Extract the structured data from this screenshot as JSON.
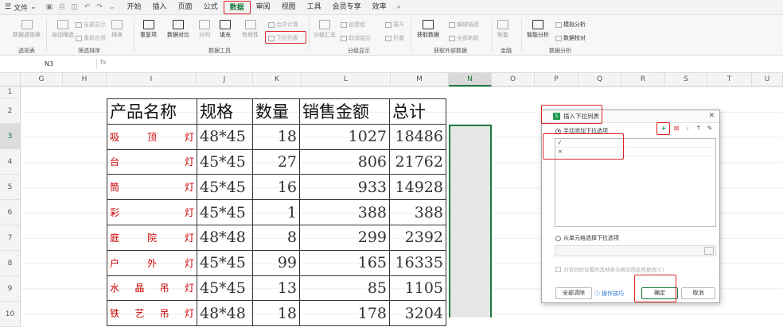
{
  "menubar": {
    "file": "文件",
    "tabs": [
      "开始",
      "插入",
      "页面",
      "公式",
      "数据",
      "审阅",
      "视图",
      "工具",
      "会员专享",
      "效率"
    ],
    "active_tab": "数据"
  },
  "ribbon": {
    "buttons": [
      "数据透视表",
      "自动筛选",
      "全部显示",
      "重新应用",
      "排序",
      "重复项",
      "数据对比",
      "分列",
      "填充",
      "有效性",
      "合并计算",
      "下拉列表",
      "分级汇总",
      "创建组",
      "取消组合",
      "展开",
      "折叠",
      "获取数据",
      "编辑链接",
      "全部刷新",
      "账套",
      "智能分析",
      "模拟分析",
      "数据校对"
    ],
    "groups": [
      "透视表",
      "筛选排序",
      "数据工具",
      "分级显示",
      "获取外部数据",
      "金融",
      "数据分析"
    ]
  },
  "formula_bar": {
    "cell_ref": "N3",
    "fx": "fx"
  },
  "columns": [
    "G",
    "H",
    "I",
    "J",
    "K",
    "L",
    "M",
    "N",
    "O",
    "P",
    "Q",
    "R",
    "S",
    "T",
    "U"
  ],
  "rows": [
    "1",
    "2",
    "3",
    "4",
    "5",
    "6",
    "7",
    "8",
    "9",
    "10"
  ],
  "table": {
    "headers": [
      "产品名称",
      "规格",
      "数量",
      "销售金额",
      "总计"
    ],
    "rows": [
      {
        "name": [
          "吸",
          "顶",
          "灯"
        ],
        "spec": "48*45",
        "qty": "18",
        "sales": "1027",
        "total": "18486"
      },
      {
        "name": [
          "台",
          "灯"
        ],
        "spec": "45*45",
        "qty": "27",
        "sales": "806",
        "total": "21762"
      },
      {
        "name": [
          "筒",
          "灯"
        ],
        "spec": "45*45",
        "qty": "16",
        "sales": "933",
        "total": "14928"
      },
      {
        "name": [
          "彩",
          "灯"
        ],
        "spec": "45*45",
        "qty": "1",
        "sales": "388",
        "total": "388"
      },
      {
        "name": [
          "庭",
          "院",
          "灯"
        ],
        "spec": "48*48",
        "qty": "8",
        "sales": "299",
        "total": "2392"
      },
      {
        "name": [
          "户",
          "外",
          "灯"
        ],
        "spec": "45*45",
        "qty": "99",
        "sales": "165",
        "total": "16335"
      },
      {
        "name": [
          "水",
          "晶",
          "吊",
          "灯"
        ],
        "spec": "45*45",
        "qty": "13",
        "sales": "85",
        "total": "1105"
      },
      {
        "name": [
          "铁",
          "艺",
          "吊",
          "灯"
        ],
        "spec": "48*48",
        "qty": "18",
        "sales": "178",
        "total": "3204"
      }
    ]
  },
  "dialog": {
    "title": "插入下拉列表",
    "option_manual": "手动添加下拉选项",
    "items": [
      "√",
      "×"
    ],
    "option_cells": "从单元格选择下拉选项",
    "apply_all": "对有同样设置的其他单元格应用这些更改(C)",
    "clear_all": "全部清除",
    "tips": "操作技巧",
    "ok": "确定",
    "cancel": "取消"
  },
  "colors": {
    "accent": "#1a7a3c",
    "highlight": "#dd2222"
  }
}
